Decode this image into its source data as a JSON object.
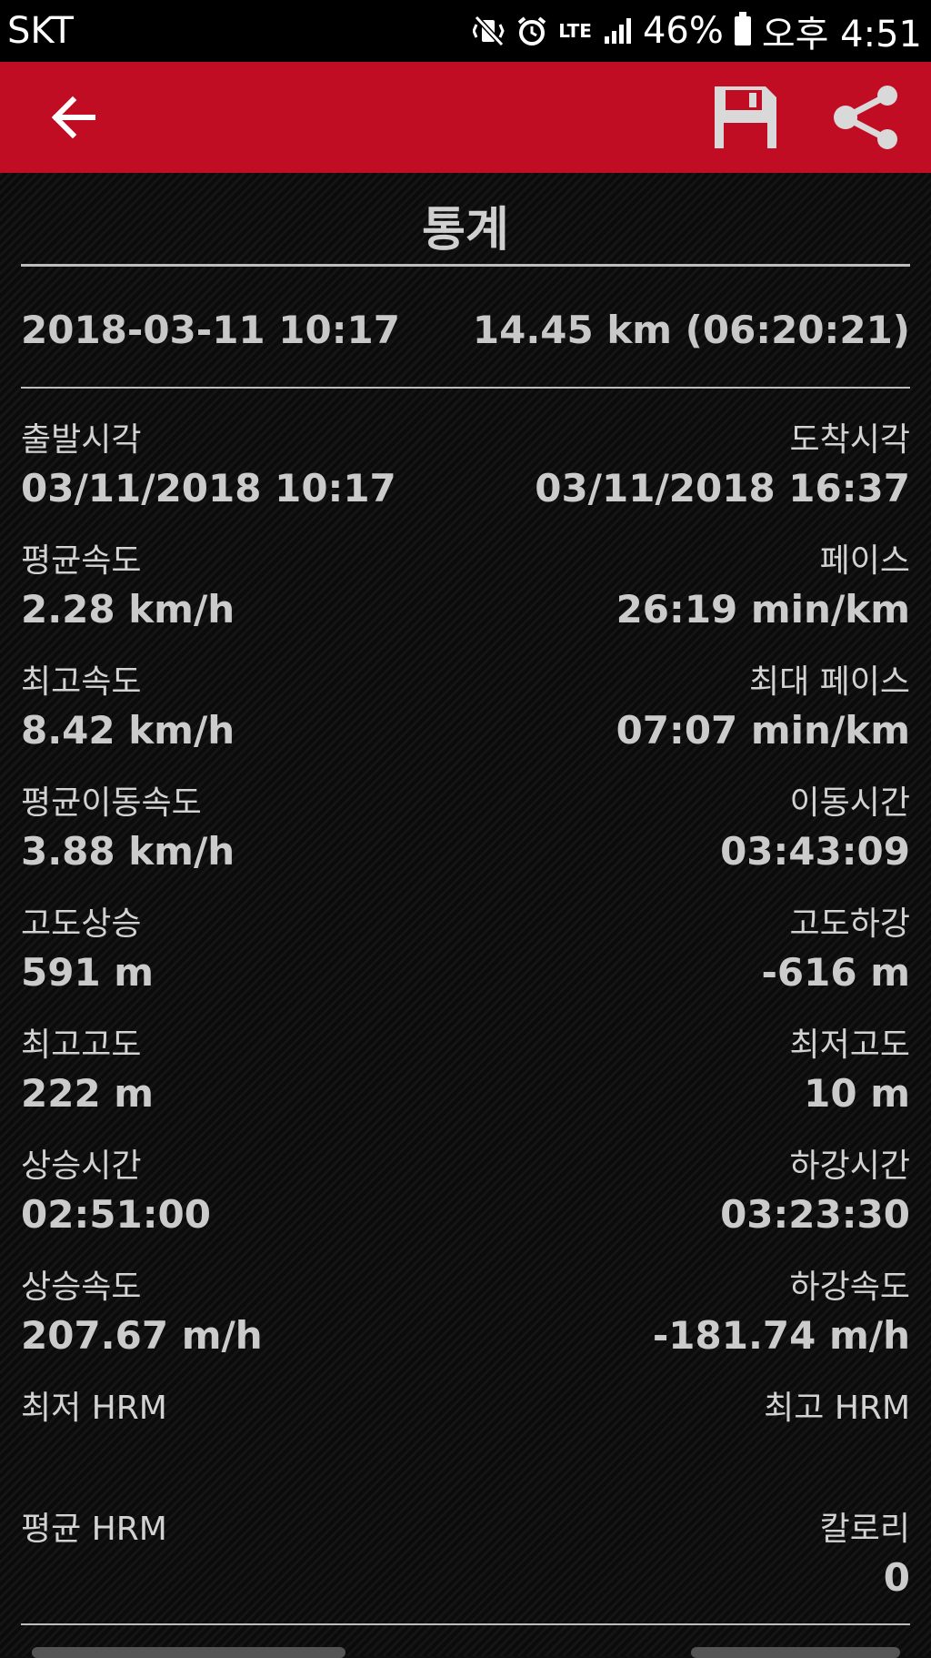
{
  "status_bar": {
    "carrier": "SKT",
    "network": "LTE",
    "battery": "46%",
    "time": "오후 4:51"
  },
  "appbar": {
    "back_icon": "arrow-left-icon",
    "save_icon": "floppy-disk-icon",
    "share_icon": "share-icon",
    "color": "#c00d24"
  },
  "page": {
    "title": "통계",
    "summary_date": "2018-03-11 10:17",
    "summary_distance": "14.45 km (06:20:21)"
  },
  "stats": [
    {
      "left_label": "출발시각",
      "left_value": "03/11/2018 10:17",
      "right_label": "도착시각",
      "right_value": "03/11/2018 16:37"
    },
    {
      "left_label": "평균속도",
      "left_value": "2.28 km/h",
      "right_label": "페이스",
      "right_value": "26:19 min/km"
    },
    {
      "left_label": "최고속도",
      "left_value": "8.42 km/h",
      "right_label": "최대 페이스",
      "right_value": "07:07 min/km"
    },
    {
      "left_label": "평균이동속도",
      "left_value": "3.88 km/h",
      "right_label": "이동시간",
      "right_value": "03:43:09"
    },
    {
      "left_label": "고도상승",
      "left_value": "591 m",
      "right_label": "고도하강",
      "right_value": "-616 m"
    },
    {
      "left_label": "최고고도",
      "left_value": "222 m",
      "right_label": "최저고도",
      "right_value": "10 m"
    },
    {
      "left_label": "상승시간",
      "left_value": "02:51:00",
      "right_label": "하강시간",
      "right_value": "03:23:30"
    },
    {
      "left_label": "상승속도",
      "left_value": "207.67 m/h",
      "right_label": "하강속도",
      "right_value": "-181.74 m/h"
    },
    {
      "left_label": "최저 HRM",
      "left_value": "",
      "right_label": "최고 HRM",
      "right_value": ""
    },
    {
      "left_label": "평균 HRM",
      "left_value": "",
      "right_label": "칼로리",
      "right_value": "0"
    }
  ]
}
